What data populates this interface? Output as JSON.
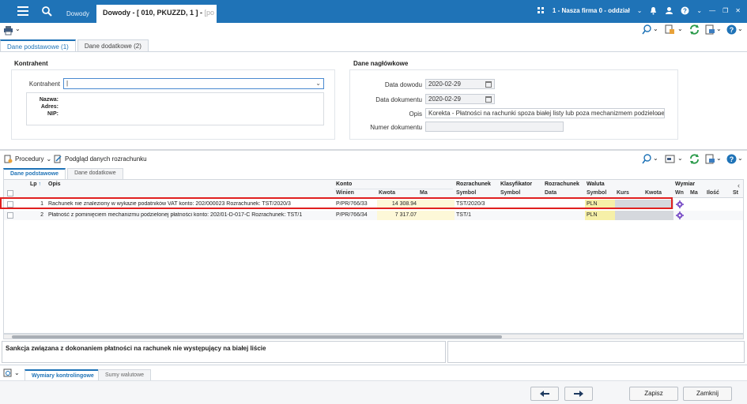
{
  "titlebar": {
    "tab_inactive": "Dowody",
    "tab_active_title": "Dowody - [ 010, PKUZZD, 1 ] - ",
    "tab_active_suffix": "[po",
    "firm": "1 - Nasza firma 0 - oddział"
  },
  "tabs": [
    "Dane podstawowe (1)",
    "Dane dodatkowe (2)"
  ],
  "kontrahent": {
    "section_title": "Kontrahent",
    "label": "Kontrahent",
    "value": "|",
    "nazwa_label": "Nazwa:",
    "adres_label": "Adres:",
    "nip_label": "NIP:"
  },
  "naglowek": {
    "section_title": "Dane nagłówkowe",
    "data_dowodu_label": "Data dowodu",
    "data_dowodu": "2020-02-29",
    "data_dokumentu_label": "Data dokumentu",
    "data_dokumentu": "2020-02-29",
    "opis_label": "Opis",
    "opis": "Korekta - Płatności na rachunki spoza białej listy lub poza mechanizmem podzielonej",
    "numer_label": "Numer dokumentu",
    "numer": ""
  },
  "toolbar2": {
    "procedury": "Procedury",
    "podglad": "Podgląd danych rozrachunku"
  },
  "grid_tabs": [
    "Dane podstawowe",
    "Dane dodatkowe"
  ],
  "grid": {
    "headers_top": {
      "lp": "Lp",
      "opis": "Opis",
      "konto": "Konto",
      "rozrachunek": "Rozrachunek",
      "klasyfikator": "Klasyfikator",
      "rozrachunek2": "Rozrachunek",
      "waluta": "Waluta",
      "wymiar": "Wymiar"
    },
    "headers_sub": {
      "winien": "Winien",
      "kwota": "Kwota",
      "ma": "Ma",
      "symbol": "Symbol",
      "symbol2": "Symbol",
      "data": "Data",
      "symbol3": "Symbol",
      "kurs": "Kurs",
      "kwota2": "Kwota",
      "wn": "Wn",
      "ma2": "Ma",
      "ilosc": "Ilość",
      "st": "St"
    },
    "rows": [
      {
        "lp": "1",
        "opis": "Rachunek nie znaleziony w wykazie podatników VAT konto: 202/000023 Rozrachunek: TST/2020/3",
        "winien": "P/PR/766/33",
        "kwota": "14 308.94",
        "symbol": "TST/2020/3",
        "waluta": "PLN"
      },
      {
        "lp": "2",
        "opis": "Płatność z pominięciem mechanizmu podzielonej płatności konto: 202/01-D-017-C Rozrachunek: TST/1",
        "winien": "P/PR/766/34",
        "kwota": "7 317.07",
        "symbol": "TST/1",
        "waluta": "PLN"
      }
    ]
  },
  "description": "Sankcja związana z dokonaniem płatności na rachunek nie występujący na białej liście",
  "bottom_tabs": [
    "Wymiary kontrolingowe",
    "Sumy walutowe"
  ],
  "buttons": {
    "zapisz": "Zapisz",
    "zamknij": "Zamknij"
  },
  "colors": {
    "brand": "#1f73b7",
    "highlight": "#e02020",
    "currency_bg": "#f6f0a8"
  }
}
